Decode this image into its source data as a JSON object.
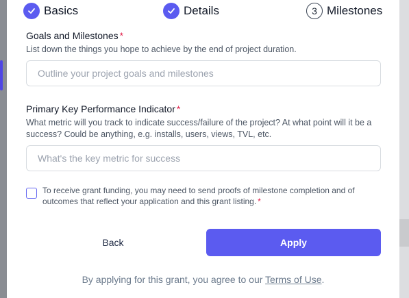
{
  "stepper": {
    "steps": [
      {
        "label": "Basics",
        "status": "done"
      },
      {
        "label": "Details",
        "status": "done"
      },
      {
        "label": "Milestones",
        "status": "current",
        "number": "3"
      }
    ]
  },
  "goals": {
    "title": "Goals and Milestones",
    "required_mark": "*",
    "description": "List down the things you hope to achieve by the end of project duration.",
    "placeholder": "Outline your project goals and milestones",
    "value": ""
  },
  "kpi": {
    "title": "Primary Key Performance Indicator",
    "required_mark": "*",
    "description": "What metric will you track to indicate success/failure of the project? At what point will it be a success? Could be anything, e.g. installs, users, views, TVL, etc.",
    "placeholder": "What's the key metric for success",
    "value": ""
  },
  "consent": {
    "checked": false,
    "text": "To receive grant funding, you may need to send proofs of milestone completion and of outcomes that reflect your application and this grant listing.",
    "required_mark": "*"
  },
  "actions": {
    "back_label": "Back",
    "apply_label": "Apply"
  },
  "footer": {
    "prefix": "By applying for this grant, you agree to our ",
    "link_label": "Terms of Use",
    "suffix": "."
  },
  "colors": {
    "accent": "#5b5bf0",
    "required": "#e11d48"
  }
}
